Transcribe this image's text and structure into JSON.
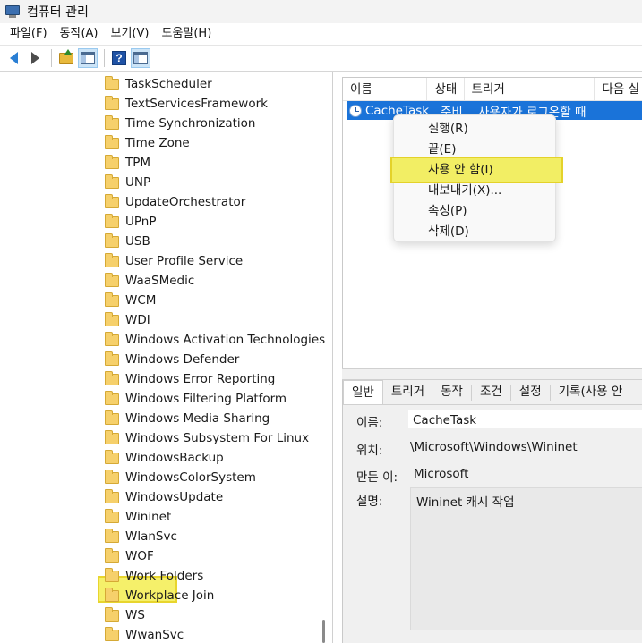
{
  "window": {
    "title": "컴퓨터 관리"
  },
  "menu": [
    "파일(F)",
    "동작(A)",
    "보기(V)",
    "도움말(H)"
  ],
  "toolbar": {
    "buttons": [
      "back-icon",
      "forward-icon",
      "up-folder-icon",
      "show-hide-tree-icon",
      "help-icon",
      "show-hide-action-pane-icon"
    ]
  },
  "tree": {
    "items": [
      "TaskScheduler",
      "TextServicesFramework",
      "Time Synchronization",
      "Time Zone",
      "TPM",
      "UNP",
      "UpdateOrchestrator",
      "UPnP",
      "USB",
      "User Profile Service",
      "WaaSMedic",
      "WCM",
      "WDI",
      "Windows Activation Technologies",
      "Windows Defender",
      "Windows Error Reporting",
      "Windows Filtering Platform",
      "Windows Media Sharing",
      "Windows Subsystem For Linux",
      "WindowsBackup",
      "WindowsColorSystem",
      "WindowsUpdate",
      "Wininet",
      "WlanSvc",
      "WOF",
      "Work Folders",
      "Workplace Join",
      "WS",
      "WwanSvc"
    ],
    "selected": "Wininet"
  },
  "task_list": {
    "columns": [
      "이름",
      "상태",
      "트리거",
      "다음 실"
    ],
    "row": {
      "name": "CacheTask",
      "status": "준비",
      "trigger": "사용자가 로그온할 때"
    }
  },
  "context_menu": {
    "items": [
      "실행(R)",
      "끝(E)",
      "사용 안 함(I)",
      "내보내기(X)...",
      "속성(P)",
      "삭제(D)"
    ],
    "highlighted": "사용 안 함(I)"
  },
  "detail": {
    "tabs": [
      "일반",
      "트리거",
      "동작",
      "조건",
      "설정",
      "기록(사용 안"
    ],
    "active_tab": "일반",
    "fields": {
      "name_label": "이름:",
      "name_value": "CacheTask",
      "location_label": "위치:",
      "location_value": "\\Microsoft\\Windows\\Wininet",
      "author_label": "만든 이:",
      "author_value": "Microsoft",
      "desc_label": "설명:",
      "desc_value": "Wininet 캐시 작업"
    }
  },
  "colors": {
    "selection": "#1a73d9",
    "highlight": "#f5f06a"
  }
}
